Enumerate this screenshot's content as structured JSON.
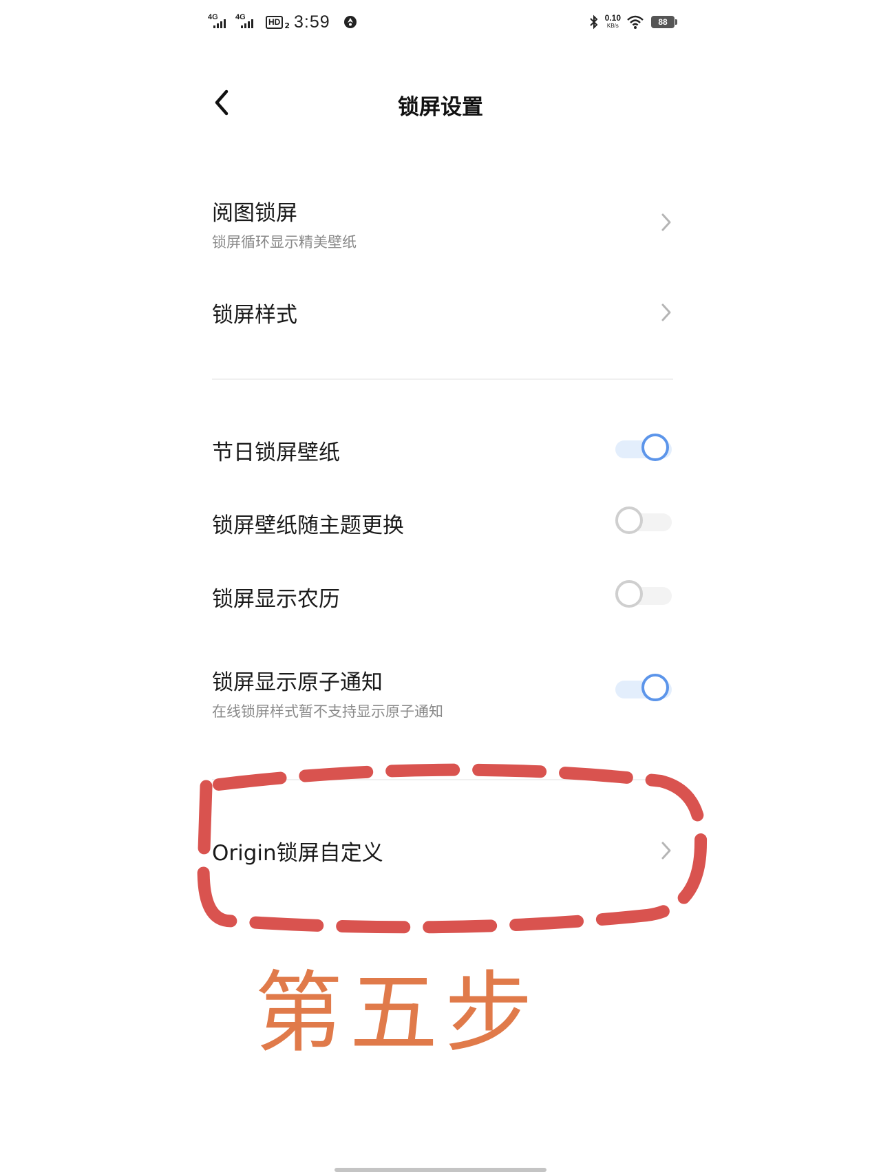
{
  "status_bar": {
    "network_1": "4G",
    "network_2": "4G",
    "hd_label": "HD",
    "hd_sub": "2",
    "time": "3:59",
    "net_speed_value": "0.10",
    "net_speed_unit": "KB/s",
    "battery": "88",
    "icons": [
      "vpn-icon",
      "bluetooth-icon",
      "wifi-icon",
      "battery-icon"
    ]
  },
  "header": {
    "title": "锁屏设置",
    "back_icon": "chevron-left-icon"
  },
  "settings": {
    "group1": [
      {
        "label": "阅图锁屏",
        "sub": "锁屏循环显示精美壁纸",
        "type": "link"
      },
      {
        "label": "锁屏样式",
        "type": "link"
      }
    ],
    "group2": [
      {
        "label": "节日锁屏壁纸",
        "type": "toggle",
        "on": true
      },
      {
        "label": "锁屏壁纸随主题更换",
        "type": "toggle",
        "on": false
      },
      {
        "label": "锁屏显示农历",
        "type": "toggle",
        "on": false
      },
      {
        "label": "锁屏显示原子通知",
        "sub": "在线锁屏样式暂不支持显示原子通知",
        "type": "toggle",
        "on": true
      }
    ],
    "group3": [
      {
        "label": "Origin锁屏自定义",
        "type": "link"
      }
    ]
  },
  "annotation": {
    "step_text": "第五步",
    "step_color": "#e07a4a",
    "highlight_color": "#d9534f"
  },
  "colors": {
    "toggle_on": "#5c95ea",
    "toggle_on_track": "#e3eefc",
    "toggle_off": "#cfcfcf"
  }
}
